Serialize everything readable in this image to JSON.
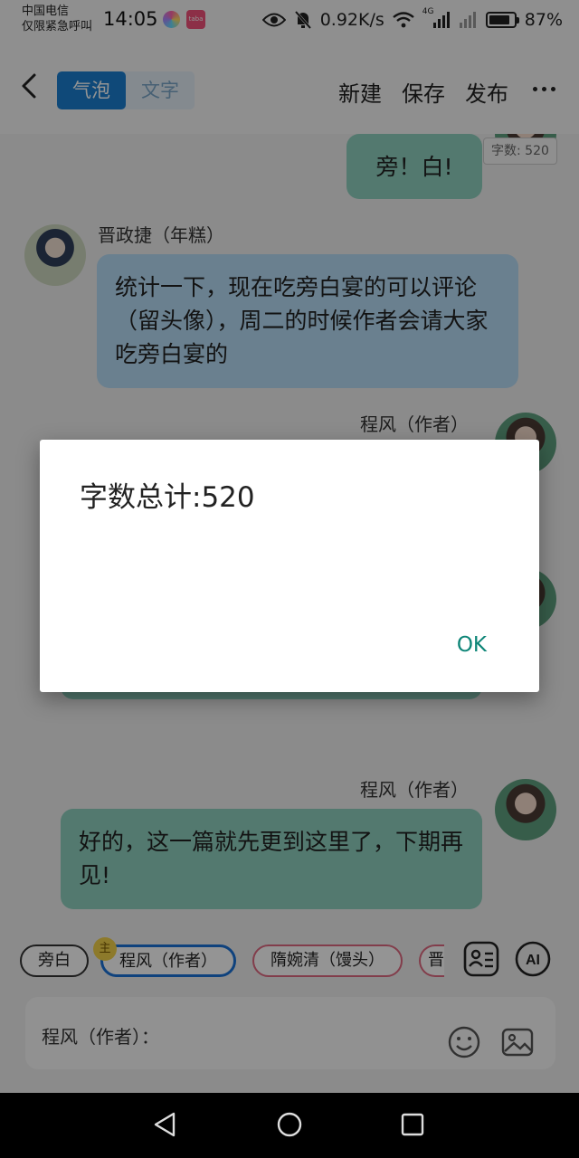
{
  "status_bar": {
    "carrier_line1": "中国电信",
    "carrier_line2": "仅限紧急呼叫",
    "time": "14:05",
    "app_icon_badge": "taba",
    "net_speed": "0.92K/s",
    "network_type": "4G",
    "battery": "87%",
    "battery_level": 0.87
  },
  "header": {
    "tabs": [
      {
        "label": "气泡",
        "active": true
      },
      {
        "label": "文字",
        "active": false
      }
    ],
    "actions": {
      "new": "新建",
      "save": "保存",
      "publish": "发布"
    }
  },
  "chat": {
    "word_count_badge": "字数: 520",
    "messages": [
      {
        "sender": "",
        "text": "旁！白!",
        "side": "right",
        "color": "teal"
      },
      {
        "sender": "晋政捷（年糕）",
        "text": "统计一下，现在吃旁白宴的可以评论（留头像），周二的时候作者会请大家吃旁白宴的",
        "side": "left",
        "color": "blue"
      },
      {
        "sender": "程风（作者）",
        "text": "",
        "side": "right",
        "color": "teal"
      },
      {
        "sender": "程风（作者）",
        "text": "好的，这一篇就先更到这里了，下期再见!",
        "side": "right",
        "color": "teal"
      }
    ]
  },
  "composer": {
    "chips": [
      {
        "label": "旁白"
      },
      {
        "label": "程风（作者）",
        "badge": "主"
      },
      {
        "label": "隋婉清（馒头）"
      },
      {
        "label": "晋"
      }
    ],
    "input_label": "程风（作者）："
  },
  "dialog": {
    "title": "字数总计:520",
    "ok": "OK"
  },
  "colors": {
    "accent": "#1a7fd0",
    "bubble_teal": "#8fd1bf",
    "bubble_blue": "#b7dcf6",
    "dialog_ok": "#0d8577"
  }
}
